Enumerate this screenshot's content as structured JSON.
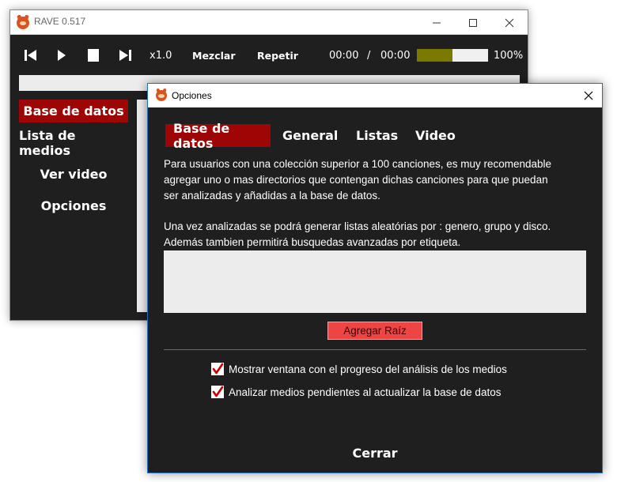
{
  "main_window": {
    "title": "RAVE 0.517",
    "controls": {
      "minimize": "—",
      "maximize": "☐",
      "close": "✕"
    }
  },
  "player": {
    "speed": "x1.0",
    "shuffle_label": "Mezclar",
    "repeat_label": "Repetir",
    "time_current": "00:00",
    "time_separator": "/",
    "time_total": "00:00",
    "volume_label": "100%",
    "volume_fill_fraction": 0.5,
    "volume_color": "#7a7a00"
  },
  "sidebar": {
    "items": [
      {
        "label": "Base de datos",
        "active": true
      },
      {
        "label": "Lista de medios",
        "active": false
      },
      {
        "label": "Ver video",
        "active": false
      },
      {
        "label": "Opciones",
        "active": false
      }
    ]
  },
  "dialog": {
    "title": "Opciones",
    "tabs": [
      {
        "label": "Base de datos",
        "active": true
      },
      {
        "label": "General",
        "active": false
      },
      {
        "label": "Listas",
        "active": false
      },
      {
        "label": "Video",
        "active": false
      }
    ],
    "description_1": [
      "Para usuarios con una colección superior a 100 canciones, es muy recomendable",
      "agregar uno o mas directorios que contengan dichas canciones para que puedan",
      "ser analizadas y añadidas a la base de datos."
    ],
    "description_2": [
      "Una vez analizadas se podrá generar listas aleatórias por : genero, grupo y disco.",
      "Además tambien permitirá busquedas avanzadas por etiqueta."
    ],
    "add_root_label": "Agregar Raíz",
    "checkboxes": [
      {
        "label": "Mostrar ventana con el progreso del análisis de los medios",
        "checked": true
      },
      {
        "label": "Analizar medios pendientes al actualizar la base de datos",
        "checked": true
      }
    ],
    "close_label": "Cerrar"
  },
  "colors": {
    "accent": "#9e0606",
    "background": "#1f1f1f",
    "button_red": "#ef4444",
    "check_mark": "#c80000"
  }
}
